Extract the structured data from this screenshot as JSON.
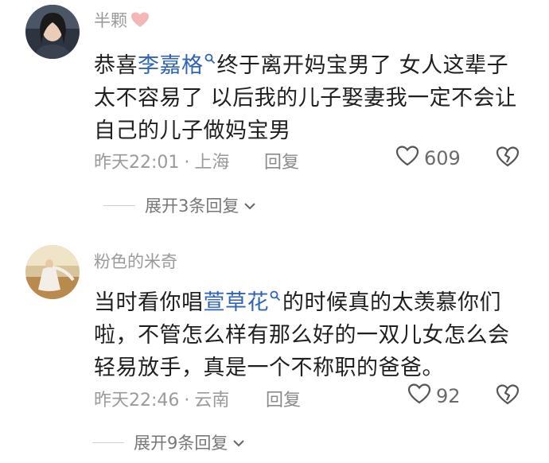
{
  "comments": [
    {
      "username": "半颗",
      "text_before": "恭喜",
      "mention": "李嘉格",
      "text_after": "终于离开妈宝男了 女人这辈子太不容易了 以后我的儿子娶妻我一定不会让自己的儿子做妈宝男",
      "time": "昨天22:01",
      "location": "上海",
      "reply_label": "回复",
      "likes": "609",
      "expand_label": "展开3条回复"
    },
    {
      "username": "粉色的米奇",
      "text_before": "当时看你唱",
      "mention": "萱草花",
      "text_after": "的时候真的太羡慕你们啦，不管怎么样有那么好的一双儿女怎么会轻易放手，真是一个不称职的爸爸。",
      "time": "昨天22:46",
      "location": "云南",
      "reply_label": "回复",
      "likes": "92",
      "expand_label": "展开9条回复"
    }
  ],
  "colors": {
    "mention": "#2f63b5",
    "meta": "#9a9a9a",
    "text": "#1f1f1f",
    "heart_badge": "#f4b6b6"
  },
  "icons": [
    "pink-heart-icon",
    "search-mention-icon",
    "like-heart-icon",
    "broken-heart-icon",
    "chevron-down-icon"
  ]
}
